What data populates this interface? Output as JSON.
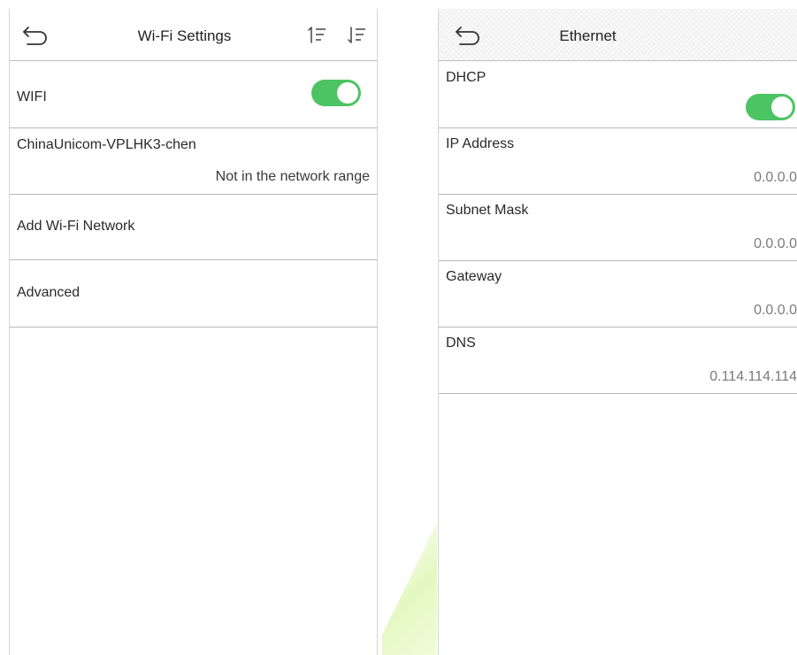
{
  "wifi_screen": {
    "title": "Wi-Fi Settings",
    "items": [
      {
        "label": "WIFI",
        "toggle_on": true
      },
      {
        "label": "ChinaUnicom-VPLHK3-chen",
        "value": "Not in the network range"
      },
      {
        "label": "Add Wi-Fi Network"
      },
      {
        "label": "Advanced"
      }
    ]
  },
  "ethernet_screen": {
    "title": "Ethernet",
    "items": [
      {
        "label": "DHCP",
        "toggle_on": true
      },
      {
        "label": "IP Address",
        "value": "0.0.0.0"
      },
      {
        "label": "Subnet Mask",
        "value": "0.0.0.0"
      },
      {
        "label": "Gateway",
        "value": "0.0.0.0"
      },
      {
        "label": "DNS",
        "value": "0.114.114.114"
      }
    ]
  },
  "icons": {
    "back": "back-arrow-icon",
    "sort_asc": "sort-ascending-icon",
    "sort_desc": "sort-descending-icon"
  },
  "colors": {
    "toggle_on": "#4cc463",
    "divider": "#b8b8b8"
  }
}
